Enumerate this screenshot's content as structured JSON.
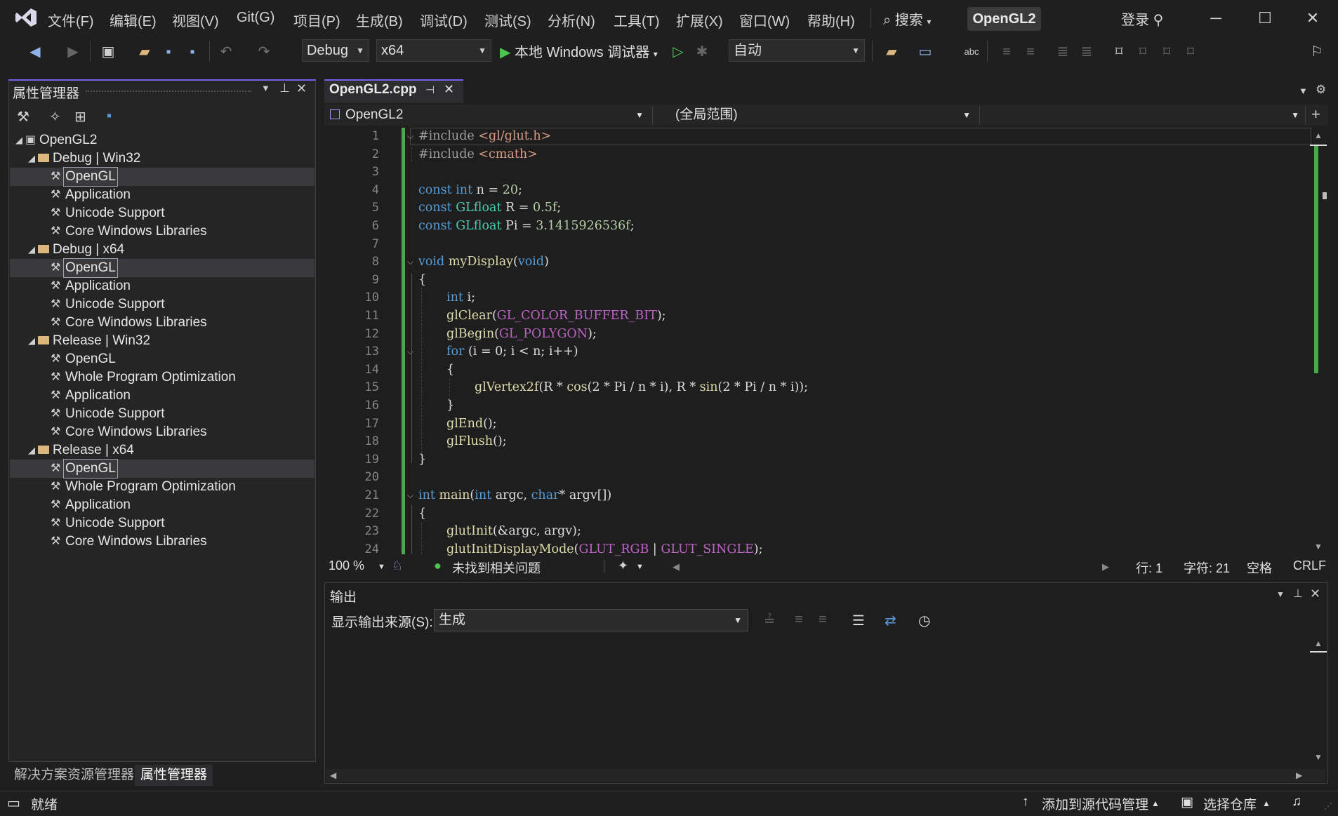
{
  "titlebar": {
    "menus": [
      "文件(F)",
      "编辑(E)",
      "视图(V)",
      "Git(G)",
      "项目(P)",
      "生成(B)",
      "调试(D)",
      "测试(S)",
      "分析(N)",
      "工具(T)",
      "扩展(X)",
      "窗口(W)",
      "帮助(H)"
    ],
    "search_label": "搜索",
    "solution_name": "OpenGL2",
    "login_label": "登录",
    "accent_color": "#7160e8"
  },
  "toolbar": {
    "config": "Debug",
    "platform": "x64",
    "run_label": "本地 Windows 调试器",
    "auto": "自动"
  },
  "property_manager": {
    "title": "属性管理器",
    "root": "OpenGL2",
    "groups": [
      {
        "name": "Debug | Win32",
        "items": [
          "OpenGL",
          "Application",
          "Unicode Support",
          "Core Windows Libraries"
        ]
      },
      {
        "name": "Debug | x64",
        "items": [
          "OpenGL",
          "Application",
          "Unicode Support",
          "Core Windows Libraries"
        ]
      },
      {
        "name": "Release | Win32",
        "items": [
          "OpenGL",
          "Whole Program Optimization",
          "Application",
          "Unicode Support",
          "Core Windows Libraries"
        ]
      },
      {
        "name": "Release | x64",
        "items": [
          "OpenGL",
          "Whole Program Optimization",
          "Application",
          "Unicode Support",
          "Core Windows Libraries"
        ]
      }
    ],
    "tabs": [
      "解决方案资源管理器",
      "属性管理器"
    ]
  },
  "editor": {
    "tab_label": "OpenGL2.cpp",
    "nav_project": "OpenGL2",
    "nav_scope": "(全局范围)",
    "line_numbers": [
      "1",
      "2",
      "3",
      "4",
      "5",
      "6",
      "7",
      "8",
      "9",
      "10",
      "11",
      "12",
      "13",
      "14",
      "15",
      "16",
      "17",
      "18",
      "19",
      "20",
      "21",
      "22",
      "23",
      "24"
    ],
    "zoom": "100 %",
    "issues": "未找到相关问题",
    "line": "行: 1",
    "char": "字符: 21",
    "spacing": "空格",
    "eol": "CRLF"
  },
  "code": {
    "l1a": "#include ",
    "l1b": "<gl/glut.h>",
    "l2a": "#include ",
    "l2b": "<cmath>",
    "const": "const",
    "int": "int",
    "GLfloat": "GLfloat",
    "l4": " n = ",
    "l4n": "20",
    "semi": ";",
    "l5": " R = ",
    "l5n": "0.5f",
    "l6": " Pi = ",
    "l6n": "3.1415926536f",
    "void": "void",
    "myDisplay": "myDisplay",
    "l8p": "(",
    "l8v": "void",
    "l8c": ")",
    "brace_open": "{",
    "brace_close": "}",
    "l10": " i;",
    "glClear": "glClear",
    "GL_COLOR_BUFFER_BIT": "GL_COLOR_BUFFER_BIT",
    "l11c": ");",
    "glBegin": "glBegin",
    "GL_POLYGON": "GL_POLYGON",
    "for": "for",
    "l13": " (i = 0; i < n; i++)",
    "glVertex2f": "glVertex2f",
    "l15a": "(R * ",
    "cos": "cos",
    "l15b": "(2 * Pi / n * i), R * ",
    "sin": "sin",
    "l15c": "(2 * Pi / n * i));",
    "glEnd": "glEnd",
    "glFlush": "glFlush",
    "callc": "();",
    "main": "main",
    "l21a": "(",
    "l21b": " argc, ",
    "char": "char",
    "l21c": "* argv[])",
    "glutInit": "glutInit",
    "l23": "(&argc, argv);",
    "glutInitDisplayMode": "glutInitDisplayMode",
    "GLUT_RGB": "GLUT_RGB",
    "pipe": " | ",
    "GLUT_SINGLE": "GLUT_SINGLE"
  },
  "output": {
    "title": "输出",
    "source_label": "显示输出来源(S):",
    "source_value": "生成"
  },
  "statusbar": {
    "ready": "就绪",
    "add_source": "添加到源代码管理",
    "select_repo": "选择仓库"
  }
}
